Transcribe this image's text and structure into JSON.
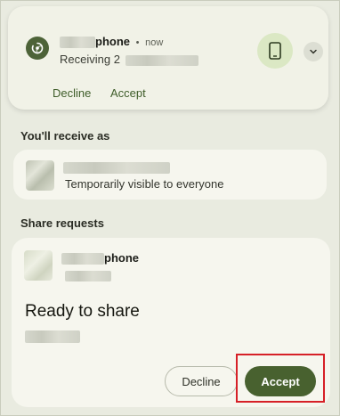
{
  "notification": {
    "device_suffix": "phone",
    "separator": "•",
    "time": "now",
    "message_prefix": "Receiving 2",
    "actions": {
      "decline": "Decline",
      "accept": "Accept"
    },
    "icons": {
      "app": "nearby-share-icon",
      "device": "phone-icon",
      "expand": "chevron-down-icon"
    }
  },
  "receive_as": {
    "section_title": "You'll receive as",
    "visibility": "Temporarily visible to everyone"
  },
  "share_requests": {
    "section_title": "Share requests",
    "device_suffix": "phone",
    "status": "Ready to share",
    "decline_label": "Decline",
    "accept_label": "Accept"
  },
  "colors": {
    "accent": "#48612f",
    "highlight": "#d62027",
    "background": "#e9ebe0"
  }
}
